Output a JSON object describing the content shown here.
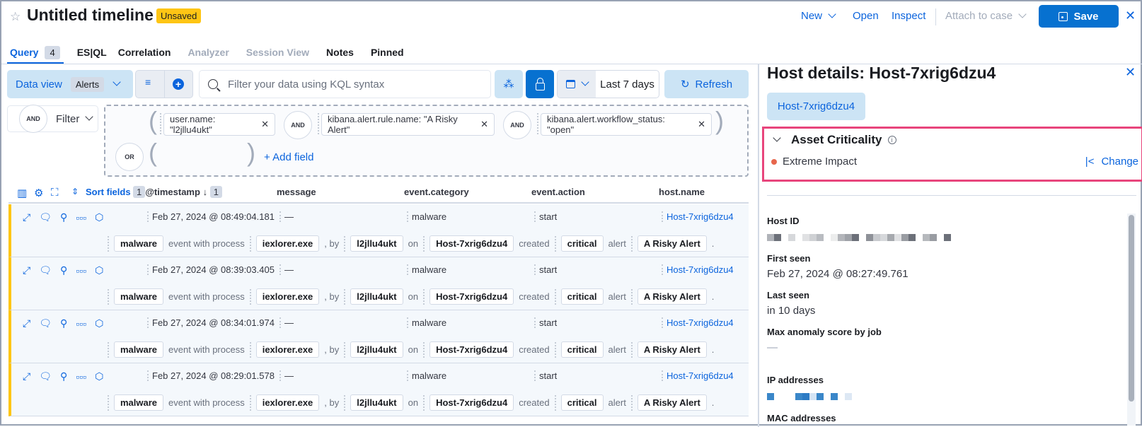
{
  "header": {
    "title": "Untitled timeline",
    "status_badge": "Unsaved",
    "new_label": "New",
    "open_label": "Open",
    "inspect_label": "Inspect",
    "attach_label": "Attach to case",
    "save_label": "Save"
  },
  "tabs": [
    {
      "label": "Query",
      "count": "4",
      "state": "active"
    },
    {
      "label": "ES|QL",
      "state": "normal"
    },
    {
      "label": "Correlation",
      "state": "normal"
    },
    {
      "label": "Analyzer",
      "state": "disabled"
    },
    {
      "label": "Session View",
      "state": "disabled"
    },
    {
      "label": "Notes",
      "state": "normal"
    },
    {
      "label": "Pinned",
      "state": "normal"
    }
  ],
  "query_bar": {
    "data_view_label": "Data view",
    "data_view_value": "Alerts",
    "kql_placeholder": "Filter your data using KQL syntax",
    "date_range": "Last 7 days",
    "refresh_label": "Refresh"
  },
  "filters": {
    "and_label": "AND",
    "filter_label": "Filter",
    "or_label": "OR",
    "pills": [
      "user.name: \"l2jllu4ukt\"",
      "kibana.alert.rule.name: \"A Risky Alert\"",
      "kibana.alert.workflow_status: \"open\""
    ],
    "add_field": "+ Add field"
  },
  "table": {
    "sort_fields": "Sort fields",
    "sort_count": "1",
    "columns": [
      "@timestamp",
      "message",
      "event.category",
      "event.action",
      "host.name"
    ],
    "timestamp_sort_count": "1",
    "rows": [
      {
        "timestamp": "Feb 27, 2024 @ 08:49:04.181",
        "message": "—",
        "category": "malware",
        "action": "start",
        "host": "Host-7xrig6dzu4"
      },
      {
        "timestamp": "Feb 27, 2024 @ 08:39:03.405",
        "message": "—",
        "category": "malware",
        "action": "start",
        "host": "Host-7xrig6dzu4"
      },
      {
        "timestamp": "Feb 27, 2024 @ 08:34:01.974",
        "message": "—",
        "category": "malware",
        "action": "start",
        "host": "Host-7xrig6dzu4"
      },
      {
        "timestamp": "Feb 27, 2024 @ 08:29:01.578",
        "message": "—",
        "category": "malware",
        "action": "start",
        "host": "Host-7xrig6dzu4"
      }
    ],
    "row_renderer": {
      "category": "malware",
      "t1": "event with process",
      "process": "iexlorer.exe",
      "t2": ", by",
      "user": "l2jllu4ukt",
      "t3": "on",
      "host": "Host-7xrig6dzu4",
      "t4": "created",
      "severity": "critical",
      "t5": "alert",
      "rule": "A Risky Alert",
      "t6": "."
    }
  },
  "flyout": {
    "title": "Host details: Host-7xrig6dzu4",
    "host_pill": "Host-7xrig6dzu4",
    "asset_criticality": {
      "title": "Asset Criticality",
      "value": "Extreme Impact",
      "value_color": "#e7664c",
      "change_label": "Change"
    },
    "fields": {
      "host_id_label": "Host ID",
      "first_seen_label": "First seen",
      "first_seen_value": "Feb 27, 2024 @ 08:27:49.761",
      "last_seen_label": "Last seen",
      "last_seen_value": "in 10 days",
      "anomaly_label": "Max anomaly score by job",
      "anomaly_value": "—",
      "ip_label": "IP addresses",
      "mac_label": "MAC addresses"
    }
  }
}
